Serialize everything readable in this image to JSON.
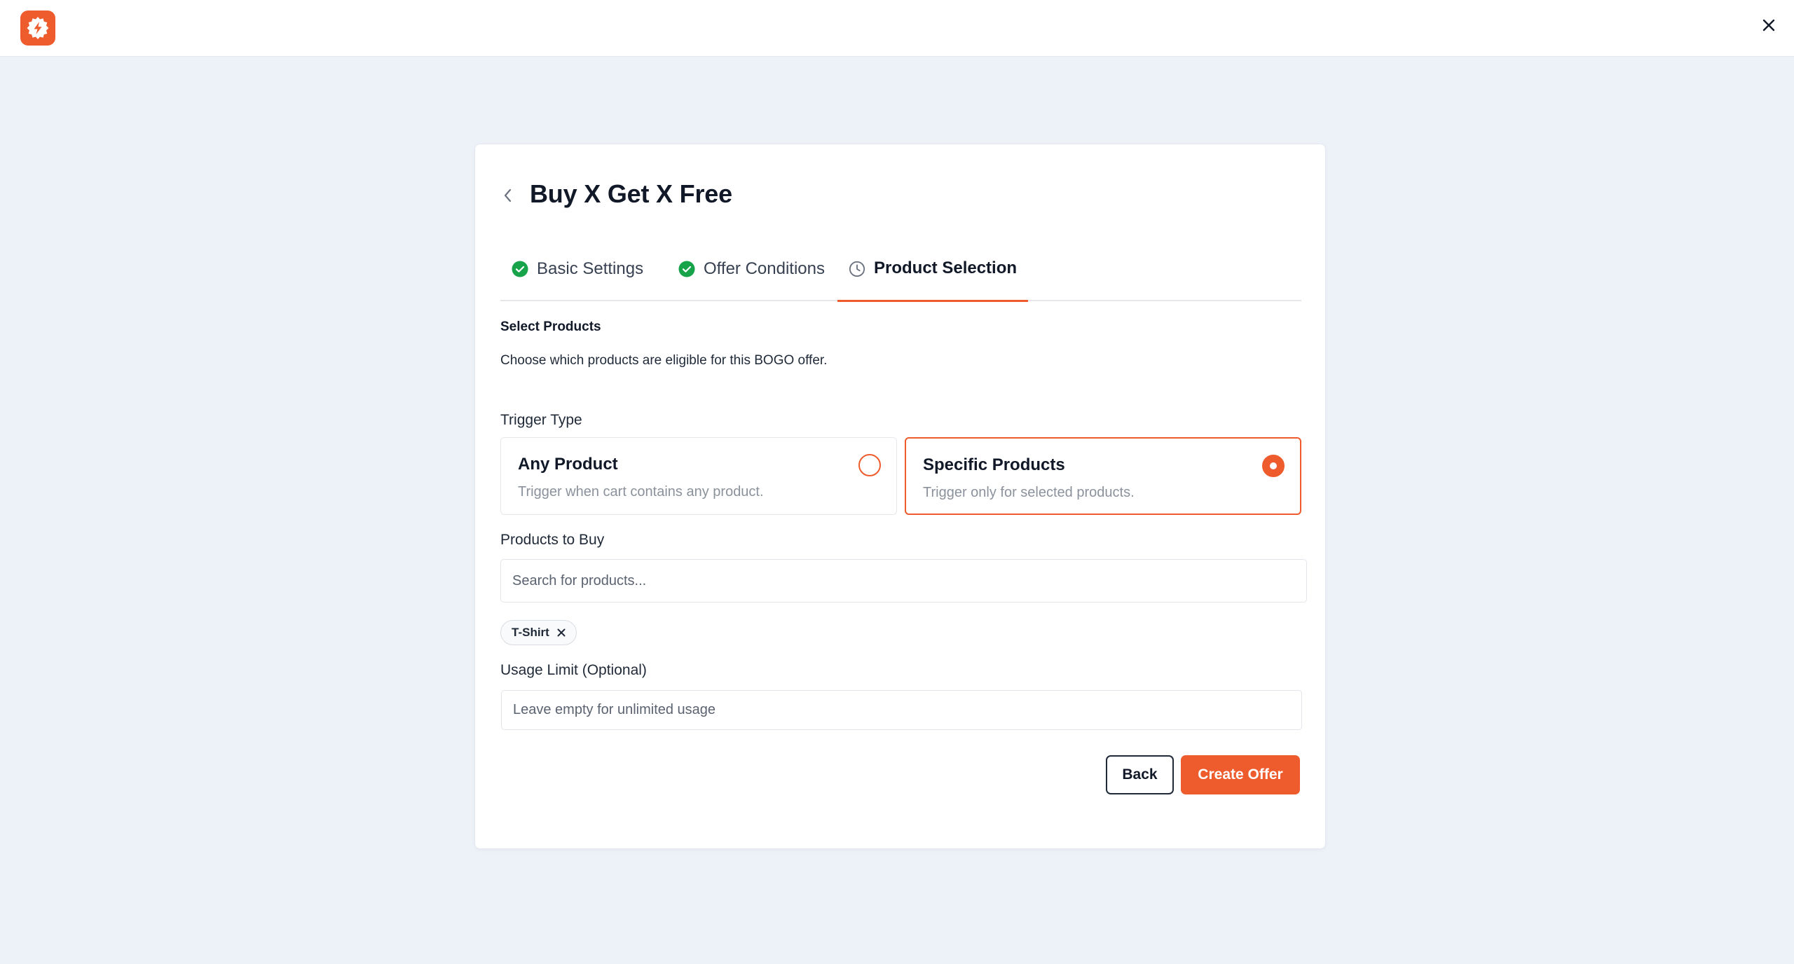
{
  "app": {
    "logo_icon": "lightning-gear-icon",
    "brand_color": "#ee5b2c",
    "close_icon": "close-icon"
  },
  "page": {
    "back_icon": "chevron-left-icon",
    "title": "Buy X Get X Free"
  },
  "tabs": [
    {
      "label": "Basic Settings",
      "icon": "check-circle-icon",
      "status": "complete"
    },
    {
      "label": "Offer Conditions",
      "icon": "check-circle-icon",
      "status": "complete"
    },
    {
      "label": "Product Selection",
      "icon": "clock-icon",
      "status": "active"
    }
  ],
  "section": {
    "title": "Select Products",
    "description": "Choose which products are eligible for this BOGO offer."
  },
  "trigger": {
    "label": "Trigger Type",
    "options": [
      {
        "title": "Any Product",
        "description": "Trigger when cart contains any product.",
        "selected": false
      },
      {
        "title": "Specific Products",
        "description": "Trigger only for selected products.",
        "selected": true
      }
    ]
  },
  "products_to_buy": {
    "label": "Products to Buy",
    "placeholder": "Search for products...",
    "value": "",
    "selected_chips": [
      {
        "label": "T-Shirt",
        "remove_icon": "close-icon"
      }
    ]
  },
  "usage_limit": {
    "label": "Usage Limit (Optional)",
    "placeholder": "Leave empty for unlimited usage",
    "value": ""
  },
  "actions": {
    "back_label": "Back",
    "create_label": "Create Offer"
  }
}
